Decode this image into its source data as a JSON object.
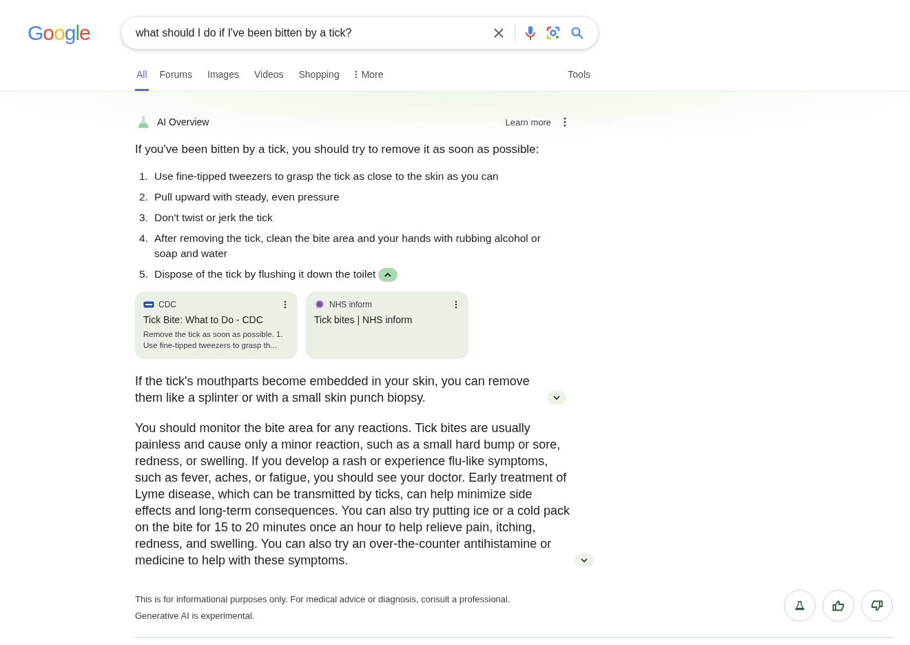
{
  "logo": [
    "G",
    "o",
    "o",
    "g",
    "l",
    "e"
  ],
  "search": {
    "value": "what should I do if I've been bitten by a tick?"
  },
  "tabs": [
    {
      "label": "All",
      "selected": true,
      "kind": "tab"
    },
    {
      "label": "Forums",
      "selected": false,
      "kind": "tab"
    },
    {
      "label": "Images",
      "selected": false,
      "kind": "tab"
    },
    {
      "label": "Videos",
      "selected": false,
      "kind": "tab"
    },
    {
      "label": "Shopping",
      "selected": false,
      "kind": "tab"
    },
    {
      "label": "More",
      "selected": false,
      "kind": "menu"
    }
  ],
  "tools": "Tools",
  "ai_overview": {
    "title": "AI Overview",
    "learn_more": "Learn more",
    "intro": "If you've been bitten by a tick, you should try to remove it as soon as possible:",
    "steps": [
      {
        "number": "1.",
        "text": "Use fine-tipped tweezers to grasp the tick as close to the skin as you can"
      },
      {
        "number": "2.",
        "text": "Pull upward with steady, even pressure"
      },
      {
        "number": "3.",
        "text": "Don't twist or jerk the tick"
      },
      {
        "number": "4.",
        "text": "After removing the tick, clean the bite area and your hands with rubbing alcohol or soap and water"
      },
      {
        "number": "5.",
        "text": "Dispose of the tick by flushing it down the toilet"
      }
    ],
    "steps_expanded": true,
    "sources": [
      {
        "kind": "cdc",
        "site": "CDC",
        "title": "Tick Bite: What to Do - CDC",
        "snippet": "Remove the tick as soon as possible. 1. Use fine-tipped tweezers to grasp th..."
      },
      {
        "kind": "nhs",
        "site": "NHS inform",
        "title": "Tick bites | NHS inform"
      }
    ],
    "paragraphs": [
      {
        "text": "If the tick's mouthparts become embedded in your skin, you can remove them like a splinter or with a small skin punch biopsy.",
        "expanded": false
      },
      {
        "text": "You should monitor the bite area for any reactions. Tick bites are usually painless and cause only a minor reaction, such as a small hard bump or sore, redness, or swelling. If you develop a rash or experience flu-like symptoms, such as fever, aches, or fatigue, you should see your doctor. Early treatment of Lyme disease, which can be transmitted by ticks, can help minimize side effects and long-term consequences. You can also try putting ice or a cold pack on the bite for 15 to 20 minutes once an hour to help relieve pain, itching, redness, and swelling. You can also try an over-the-counter antihistamine or medicine to help with these symptoms.",
        "expanded": false
      }
    ],
    "disclaimer": [
      "This is for informational purposes only. For medical advice or diagnosis, consult a professional.",
      "Generative AI is experimental."
    ]
  }
}
